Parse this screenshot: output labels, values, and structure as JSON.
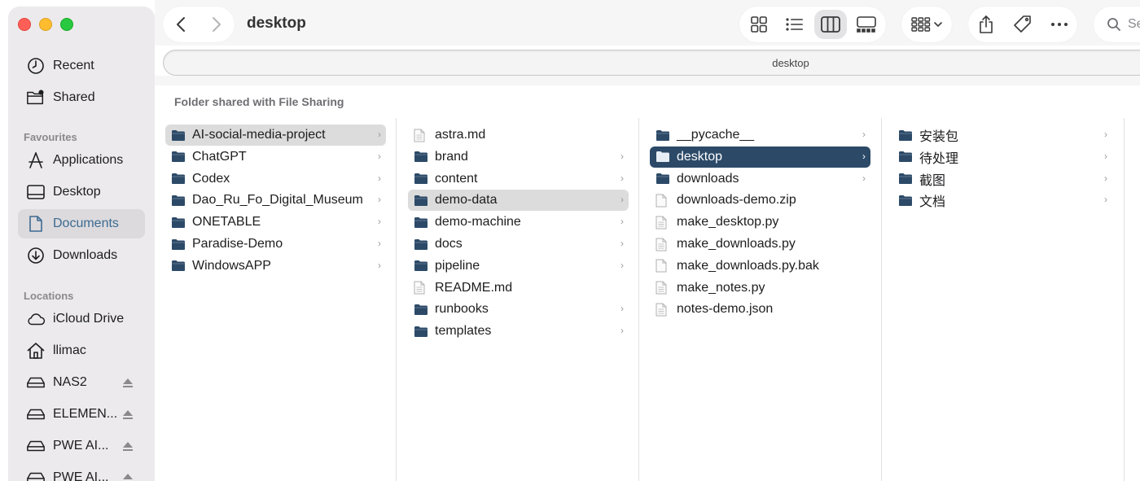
{
  "window": {
    "title": "desktop",
    "path_label": "desktop"
  },
  "search": {
    "placeholder": "Se"
  },
  "sidebar": {
    "items": [
      {
        "label": "Recent",
        "icon": "clock-icon"
      },
      {
        "label": "Shared",
        "icon": "shared-folder-icon"
      }
    ],
    "favourites_heading": "Favourites",
    "favourites": [
      {
        "label": "Applications",
        "icon": "applications-icon"
      },
      {
        "label": "Desktop",
        "icon": "desktop-icon"
      },
      {
        "label": "Documents",
        "icon": "document-icon",
        "active": true
      },
      {
        "label": "Downloads",
        "icon": "download-icon"
      }
    ],
    "locations_heading": "Locations",
    "locations": [
      {
        "label": "iCloud Drive",
        "icon": "cloud-icon"
      },
      {
        "label": "llimac",
        "icon": "home-icon"
      },
      {
        "label": "NAS2",
        "icon": "drive-icon",
        "eject": true
      },
      {
        "label": "ELEMEN...",
        "icon": "drive-icon",
        "eject": true
      },
      {
        "label": "PWE AI...",
        "icon": "drive-icon",
        "eject": true
      },
      {
        "label": "PWE AI...",
        "icon": "drive-icon",
        "eject": true
      }
    ]
  },
  "section_header": "Folder shared with File Sharing",
  "columns": [
    [
      {
        "name": "AI-social-media-project",
        "type": "folder",
        "chevron": true,
        "state": "gray"
      },
      {
        "name": "ChatGPT",
        "type": "folder",
        "chevron": true
      },
      {
        "name": "Codex",
        "type": "folder",
        "chevron": true
      },
      {
        "name": "Dao_Ru_Fo_Digital_Museum",
        "type": "folder",
        "chevron": true
      },
      {
        "name": "ONETABLE",
        "type": "folder",
        "chevron": true
      },
      {
        "name": "Paradise-Demo",
        "type": "folder",
        "chevron": true
      },
      {
        "name": "WindowsAPP",
        "type": "folder",
        "chevron": true
      }
    ],
    [
      {
        "name": "astra.md",
        "type": "doc"
      },
      {
        "name": "brand",
        "type": "folder",
        "chevron": true
      },
      {
        "name": "content",
        "type": "folder",
        "chevron": true
      },
      {
        "name": "demo-data",
        "type": "folder",
        "chevron": true,
        "state": "gray"
      },
      {
        "name": "demo-machine",
        "type": "folder",
        "chevron": true
      },
      {
        "name": "docs",
        "type": "folder",
        "chevron": true
      },
      {
        "name": "pipeline",
        "type": "folder",
        "chevron": true
      },
      {
        "name": "README.md",
        "type": "doc"
      },
      {
        "name": "runbooks",
        "type": "folder",
        "chevron": true
      },
      {
        "name": "templates",
        "type": "folder",
        "chevron": true
      }
    ],
    [
      {
        "name": "__pycache__",
        "type": "folder",
        "chevron": true
      },
      {
        "name": "desktop",
        "type": "folder",
        "chevron": true,
        "state": "blue"
      },
      {
        "name": "downloads",
        "type": "folder",
        "chevron": true
      },
      {
        "name": "downloads-demo.zip",
        "type": "file"
      },
      {
        "name": "make_desktop.py",
        "type": "doc"
      },
      {
        "name": "make_downloads.py",
        "type": "doc"
      },
      {
        "name": "make_downloads.py.bak",
        "type": "file"
      },
      {
        "name": "make_notes.py",
        "type": "doc"
      },
      {
        "name": "notes-demo.json",
        "type": "doc"
      }
    ],
    [
      {
        "name": "安装包",
        "type": "folder",
        "chevron": true
      },
      {
        "name": "待处理",
        "type": "folder",
        "chevron": true
      },
      {
        "name": "截图",
        "type": "folder",
        "chevron": true
      },
      {
        "name": "文档",
        "type": "folder",
        "chevron": true
      }
    ]
  ],
  "colors": {
    "folder": "#2c4a68",
    "selection": "#2c4a68",
    "active_text": "#3c6b91"
  }
}
